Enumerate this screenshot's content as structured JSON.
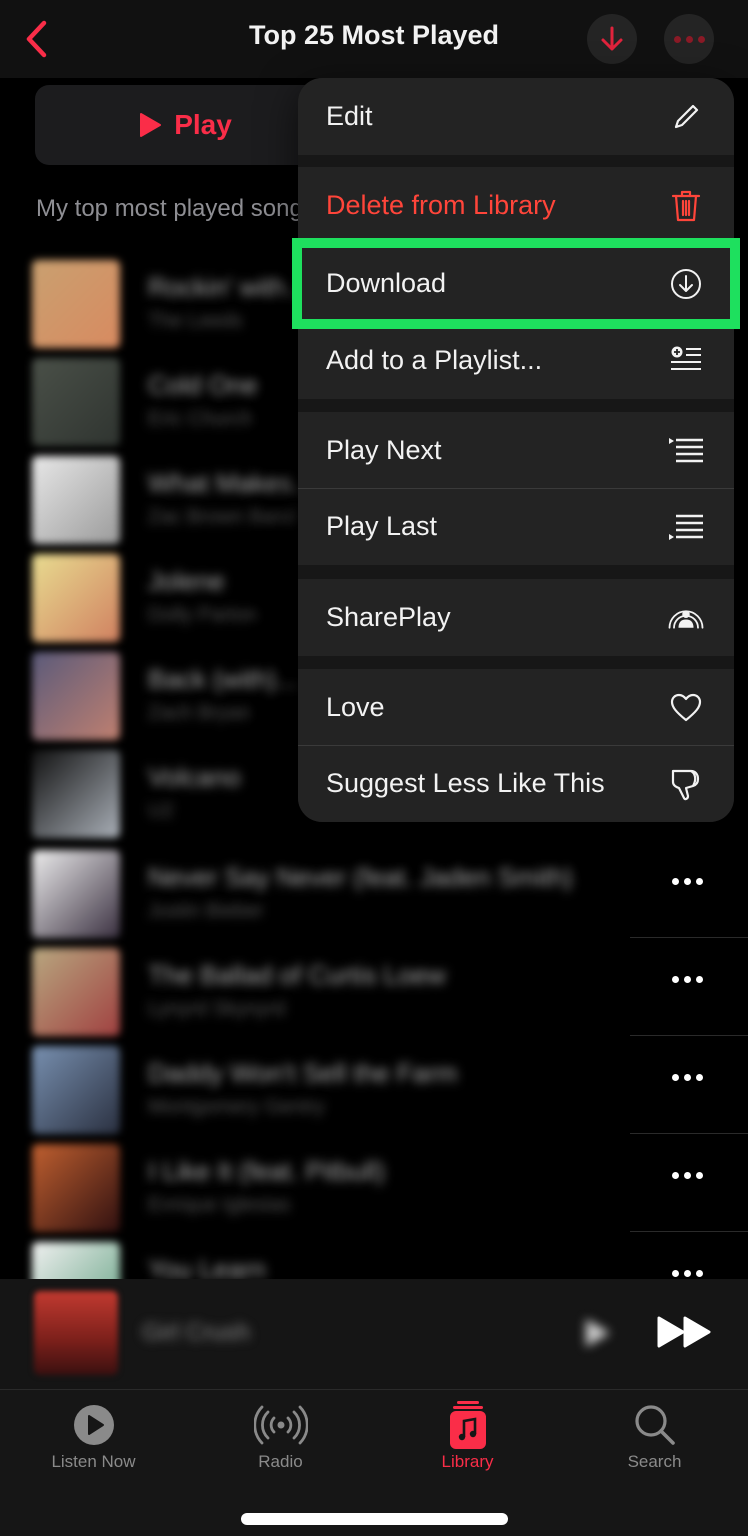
{
  "header": {
    "title": "Top 25 Most Played",
    "back_icon": "chevron-left-icon",
    "download_icon": "arrow-down-icon",
    "more_icon": "ellipsis-icon"
  },
  "play_button": {
    "label": "Play",
    "icon": "play-icon"
  },
  "description": "My top most played songs",
  "songs": [
    {
      "title": "Rockin' with...",
      "artist": "The Leeds",
      "art": [
        "#c9a070",
        "#d88a60"
      ]
    },
    {
      "title": "Cold One",
      "artist": "Eric Church",
      "art": [
        "#4a5048",
        "#2f3430"
      ]
    },
    {
      "title": "What Makes...",
      "artist": "Zac Brown Band",
      "art": [
        "#e8e8e8",
        "#9a9a9a"
      ]
    },
    {
      "title": "Jolene",
      "artist": "Dolly Parton",
      "art": [
        "#e8dc90",
        "#d08060"
      ]
    },
    {
      "title": "Back (with)...",
      "artist": "Zach Bryan",
      "art": [
        "#5a5a7a",
        "#c08070"
      ]
    },
    {
      "title": "Volcano",
      "artist": "U2",
      "art": [
        "#111111",
        "#aab0b8"
      ]
    },
    {
      "title": "Never Say Never (feat. Jaden Smith)",
      "artist": "Justin Bieber",
      "art": [
        "#eeeeee",
        "#3a3040"
      ]
    },
    {
      "title": "The Ballad of Curtis Loew",
      "artist": "Lynyrd Skynyrd",
      "art": [
        "#b8a880",
        "#a04040"
      ]
    },
    {
      "title": "Daddy Won't Sell the Farm",
      "artist": "Montgomery Gentry",
      "art": [
        "#7890b0",
        "#2a3040"
      ]
    },
    {
      "title": "I Like It (feat. Pitbull)",
      "artist": "Enrique Iglesias",
      "art": [
        "#c06030",
        "#301010"
      ]
    },
    {
      "title": "You Learn",
      "artist": "",
      "art": [
        "#f0f0f0",
        "#60a080"
      ]
    }
  ],
  "menu": {
    "items": [
      {
        "label": "Edit",
        "icon": "pencil-icon",
        "style": "normal"
      },
      {
        "label": "Delete from Library",
        "icon": "trash-icon",
        "style": "destructive"
      },
      {
        "label": "Download",
        "icon": "download-circle-icon",
        "style": "normal",
        "highlighted": true
      },
      {
        "label": "Add to a Playlist...",
        "icon": "add-to-playlist-icon",
        "style": "normal"
      },
      {
        "label": "Play Next",
        "icon": "play-next-icon",
        "style": "normal"
      },
      {
        "label": "Play Last",
        "icon": "play-last-icon",
        "style": "normal"
      },
      {
        "label": "SharePlay",
        "icon": "shareplay-icon",
        "style": "normal"
      },
      {
        "label": "Love",
        "icon": "heart-icon",
        "style": "normal"
      },
      {
        "label": "Suggest Less Like This",
        "icon": "thumbs-down-icon",
        "style": "normal"
      }
    ]
  },
  "mini_player": {
    "title": "Girl Crush",
    "play_icon": "play-icon",
    "forward_icon": "fast-forward-icon"
  },
  "tabs": [
    {
      "label": "Listen Now",
      "icon": "listen-now-icon",
      "active": false
    },
    {
      "label": "Radio",
      "icon": "radio-icon",
      "active": false
    },
    {
      "label": "Library",
      "icon": "library-icon",
      "active": true
    },
    {
      "label": "Search",
      "icon": "search-icon",
      "active": false
    }
  ],
  "colors": {
    "accent": "#fa2d48",
    "destructive": "#ff453a",
    "highlight_box": "#1ee05e",
    "menu_bg": "#232323"
  }
}
